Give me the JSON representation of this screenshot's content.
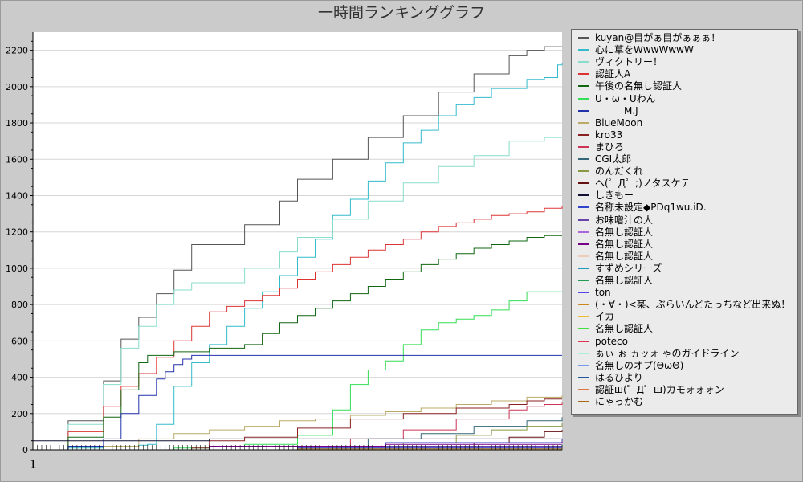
{
  "chart_data": {
    "type": "line",
    "title": "一時間ランキンググラフ",
    "xlabel": "",
    "ylabel": "",
    "x_tick_label": "1",
    "ylim": [
      0,
      2300
    ],
    "yticks": [
      0,
      200,
      400,
      600,
      800,
      1000,
      1200,
      1400,
      1600,
      1800,
      2000,
      2200
    ],
    "ytick_labels": [
      "0",
      "200",
      "400",
      "600",
      "800",
      "1000",
      "1200",
      "1400",
      "1600",
      "1800",
      "2000",
      "2200"
    ],
    "xlim": [
      0,
      60
    ],
    "grid": true,
    "legend_position": "right",
    "series": [
      {
        "name": "kuyan@目がぁ目がぁぁぁ！",
        "color": "#555555",
        "x": [
          0,
          4,
          8,
          10,
          12,
          14,
          16,
          18,
          20,
          22,
          24,
          26,
          28,
          30,
          32,
          34,
          36,
          38,
          40,
          42,
          44,
          46,
          48,
          50,
          52,
          54,
          56,
          58,
          60
        ],
        "y": [
          0,
          160,
          380,
          610,
          730,
          860,
          990,
          1130,
          1130,
          1130,
          1240,
          1240,
          1370,
          1490,
          1490,
          1600,
          1600,
          1720,
          1720,
          1840,
          1840,
          1970,
          1970,
          2070,
          2070,
          2170,
          2200,
          2220,
          2220
        ]
      },
      {
        "name": "心に草をWwwWwwW",
        "color": "#33bbcc",
        "x": [
          0,
          4,
          8,
          12,
          13,
          14,
          16,
          18,
          20,
          22,
          24,
          26,
          28,
          30,
          32,
          34,
          36,
          38,
          40,
          42,
          44,
          46,
          48,
          50,
          52,
          54,
          56,
          58,
          59.5,
          60
        ],
        "y": [
          0,
          10,
          20,
          25,
          30,
          140,
          350,
          480,
          580,
          680,
          780,
          870,
          960,
          1060,
          1160,
          1290,
          1380,
          1480,
          1580,
          1690,
          1760,
          1840,
          1900,
          1940,
          1990,
          1990,
          2040,
          2050,
          2120,
          2130
        ]
      },
      {
        "name": "ヴィクトリー！",
        "color": "#88ddcc",
        "x": [
          0,
          4,
          8,
          10,
          12,
          14,
          16,
          18,
          20,
          22,
          24,
          26,
          28,
          30,
          32,
          34,
          36,
          38,
          40,
          42,
          44,
          46,
          48,
          50,
          52,
          54,
          56,
          58,
          60
        ],
        "y": [
          0,
          140,
          360,
          560,
          680,
          800,
          880,
          920,
          920,
          920,
          1000,
          1000,
          1090,
          1170,
          1170,
          1270,
          1270,
          1370,
          1370,
          1470,
          1470,
          1560,
          1560,
          1620,
          1620,
          1700,
          1700,
          1720,
          1720
        ]
      },
      {
        "name": "認証人A",
        "color": "#dd3333",
        "x": [
          0,
          4,
          8,
          10,
          12,
          14,
          16,
          18,
          20,
          22,
          24,
          26,
          28,
          30,
          32,
          34,
          36,
          38,
          40,
          42,
          44,
          46,
          48,
          50,
          52,
          54,
          56,
          58,
          60
        ],
        "y": [
          0,
          100,
          240,
          350,
          420,
          510,
          600,
          680,
          760,
          790,
          820,
          850,
          890,
          940,
          980,
          1020,
          1060,
          1100,
          1130,
          1160,
          1200,
          1230,
          1250,
          1270,
          1290,
          1300,
          1310,
          1330,
          1340
        ]
      },
      {
        "name": "午後の名無し認証人",
        "color": "#116611",
        "x": [
          0,
          4,
          8,
          10,
          12,
          13,
          16,
          20,
          24,
          26,
          28,
          30,
          32,
          34,
          36,
          38,
          40,
          42,
          44,
          46,
          48,
          50,
          52,
          54,
          56,
          58,
          60
        ],
        "y": [
          0,
          70,
          180,
          330,
          480,
          520,
          540,
          560,
          580,
          640,
          700,
          740,
          780,
          820,
          860,
          900,
          940,
          980,
          1020,
          1050,
          1080,
          1110,
          1130,
          1150,
          1170,
          1180,
          1180
        ]
      },
      {
        "name": "U・ω・Uわん",
        "color": "#33dd55",
        "x": [
          0,
          16,
          20,
          24,
          30,
          34,
          36,
          38,
          40,
          42,
          44,
          46,
          48,
          50,
          52,
          54,
          56,
          58,
          60
        ],
        "y": [
          0,
          10,
          20,
          30,
          80,
          220,
          360,
          440,
          490,
          580,
          660,
          700,
          720,
          740,
          770,
          820,
          870,
          870,
          870
        ]
      },
      {
        "name": "　　　M.J",
        "color": "#2233aa",
        "x": [
          0,
          4,
          8,
          10,
          12,
          14,
          15,
          16,
          17,
          18,
          60
        ],
        "y": [
          0,
          20,
          60,
          200,
          300,
          390,
          430,
          470,
          500,
          520,
          520
        ]
      },
      {
        "name": "BlueMoon",
        "color": "#bbaa66",
        "x": [
          0,
          8,
          12,
          16,
          20,
          24,
          28,
          32,
          36,
          40,
          44,
          48,
          52,
          56,
          60
        ],
        "y": [
          0,
          20,
          60,
          90,
          110,
          130,
          160,
          170,
          190,
          210,
          230,
          250,
          270,
          290,
          300
        ]
      },
      {
        "name": "kro33",
        "color": "#882222",
        "x": [
          0,
          18,
          20,
          24,
          30,
          36,
          42,
          48,
          54,
          56,
          58,
          60
        ],
        "y": [
          0,
          10,
          50,
          70,
          120,
          170,
          200,
          230,
          250,
          270,
          280,
          280
        ]
      },
      {
        "name": "まひろ",
        "color": "#cc3355",
        "x": [
          0,
          30,
          36,
          42,
          48,
          54,
          56,
          58,
          60
        ],
        "y": [
          0,
          20,
          60,
          110,
          170,
          220,
          240,
          250,
          260
        ]
      },
      {
        "name": "CGI太郎",
        "color": "#336677",
        "x": [
          0,
          30,
          38,
          44,
          50,
          56,
          60
        ],
        "y": [
          0,
          10,
          60,
          90,
          130,
          160,
          180
        ]
      },
      {
        "name": "のんだくれ",
        "color": "#889944",
        "x": [
          0,
          36,
          42,
          48,
          52,
          56,
          60
        ],
        "y": [
          0,
          10,
          40,
          80,
          110,
          130,
          150
        ]
      },
      {
        "name": "ヘ(゜Д゜;)ノタスケテ",
        "color": "#661111",
        "x": [
          0,
          44,
          50,
          54,
          58,
          60
        ],
        "y": [
          0,
          10,
          40,
          70,
          100,
          110
        ]
      },
      {
        "name": "しきもー",
        "color": "#111133",
        "x": [
          0,
          20,
          60
        ],
        "y": [
          50,
          60,
          60
        ]
      },
      {
        "name": "名称未設定◆PDq1wu.iD.",
        "color": "#3344cc",
        "x": [
          0,
          20,
          40,
          60
        ],
        "y": [
          0,
          20,
          40,
          60
        ]
      },
      {
        "name": "お味噌汁の人",
        "color": "#6644aa",
        "x": [
          0,
          30,
          60
        ],
        "y": [
          0,
          20,
          50
        ]
      },
      {
        "name": "名無し認証人",
        "color": "#aa66dd",
        "x": [
          0,
          30,
          60
        ],
        "y": [
          0,
          15,
          40
        ]
      },
      {
        "name": "名無し認証人",
        "color": "#770088",
        "x": [
          0,
          20,
          40,
          60
        ],
        "y": [
          0,
          20,
          30,
          45
        ]
      },
      {
        "name": "名無し認証人",
        "color": "#eeccbb",
        "x": [
          0,
          30,
          60
        ],
        "y": [
          0,
          15,
          35
        ]
      },
      {
        "name": "すずめシリーズ",
        "color": "#2299bb",
        "x": [
          0,
          30,
          60
        ],
        "y": [
          0,
          10,
          30
        ]
      },
      {
        "name": "名無し認証人",
        "color": "#229955",
        "x": [
          0,
          30,
          60
        ],
        "y": [
          0,
          10,
          25
        ]
      },
      {
        "name": "ton",
        "color": "#5544ee",
        "x": [
          0,
          30,
          60
        ],
        "y": [
          0,
          10,
          20
        ]
      },
      {
        "name": "(・∀・)<某、ぶらいんどたっちなど出来ぬ！",
        "color": "#cc8822",
        "x": [
          0,
          30,
          60
        ],
        "y": [
          0,
          5,
          15
        ]
      },
      {
        "name": "イカ",
        "color": "#eebb33",
        "x": [
          0,
          60
        ],
        "y": [
          0,
          10
        ]
      },
      {
        "name": "名無し認証人",
        "color": "#44dd44",
        "x": [
          0,
          60
        ],
        "y": [
          0,
          8
        ]
      },
      {
        "name": "poteco",
        "color": "#dd3355",
        "x": [
          0,
          60
        ],
        "y": [
          0,
          6
        ]
      },
      {
        "name": "ぁぃ ぉ ヵッォ ゃのガイドライン",
        "color": "#aaeedd",
        "x": [
          0,
          60
        ],
        "y": [
          0,
          5
        ]
      },
      {
        "name": "名無しのオプ(ΘωΘ)",
        "color": "#7799ee",
        "x": [
          0,
          60
        ],
        "y": [
          0,
          4
        ]
      },
      {
        "name": "はるひより",
        "color": "#225599",
        "x": [
          0,
          60
        ],
        "y": [
          0,
          3
        ]
      },
      {
        "name": "認証ш(゜Д゜ш)カモォォォン",
        "color": "#dd7744",
        "x": [
          0,
          60
        ],
        "y": [
          0,
          2
        ]
      },
      {
        "name": "にゃっかむ",
        "color": "#aa6611",
        "x": [
          0,
          60
        ],
        "y": [
          0,
          1
        ]
      }
    ]
  }
}
